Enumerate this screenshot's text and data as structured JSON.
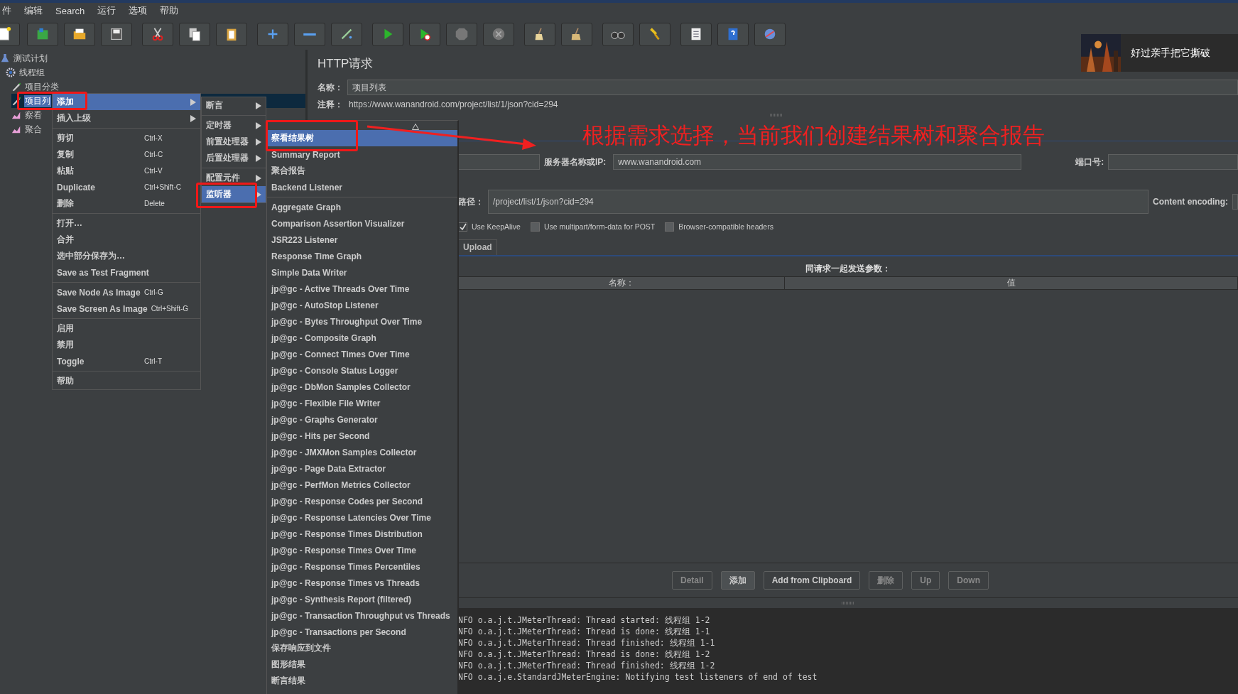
{
  "menu_bar": [
    "件",
    "编辑",
    "Search",
    "运行",
    "选项",
    "帮助"
  ],
  "notification": {
    "text": "好过亲手把它撕破"
  },
  "tree": [
    {
      "kind": "plan",
      "label": "测试计划",
      "selected": false,
      "children": [
        {
          "kind": "thread_group",
          "label": "线程组",
          "selected": false,
          "children": [
            {
              "kind": "sampler",
              "label": "项目分类",
              "selected": false
            },
            {
              "kind": "sampler",
              "label": "项目列",
              "selected": true
            },
            {
              "kind": "listener",
              "label": "察看",
              "selected": false
            },
            {
              "kind": "listener",
              "label": "聚合",
              "selected": false
            }
          ]
        }
      ]
    }
  ],
  "editor": {
    "title": "HTTP请求",
    "name_label": "名称：",
    "name_value": "项目列表",
    "comment_label": "注释：",
    "comment_value": "https://www.wanandroid.com/project/list/1/json?cid=294",
    "server_label": "服务器名称或IP:",
    "server_value": "www.wanandroid.com",
    "port_label": "端口号:",
    "path_label": "路径：",
    "path_value": "/project/list/1/json?cid=294",
    "encoding_label": "Content encoding:",
    "options": [
      {
        "label": "Use KeepAlive",
        "checked": true
      },
      {
        "label": "Use multipart/form-data for POST",
        "checked": false
      },
      {
        "label": "Browser-compatible headers",
        "checked": false
      }
    ],
    "tabs": [
      {
        "label": "Upload",
        "selected": false
      }
    ],
    "params_title": "同请求一起发送参数：",
    "columns": [
      "名称：",
      "值"
    ],
    "buttons": [
      {
        "label": "Detail",
        "disabled": true
      },
      {
        "label": "添加",
        "disabled": false
      },
      {
        "label": "Add from Clipboard",
        "disabled": false
      },
      {
        "label": "删除",
        "disabled": true
      },
      {
        "label": "Up",
        "disabled": true
      },
      {
        "label": "Down",
        "disabled": true
      }
    ]
  },
  "log": [
    "NFO o.a.j.t.JMeterThread: Thread started: 线程组 1-2",
    "NFO o.a.j.t.JMeterThread: Thread is done: 线程组 1-1",
    "NFO o.a.j.t.JMeterThread: Thread finished: 线程组 1-1",
    "NFO o.a.j.t.JMeterThread: Thread is done: 线程组 1-2",
    "NFO o.a.j.t.JMeterThread: Thread finished: 线程组 1-2",
    "NFO o.a.j.e.StandardJMeterEngine: Notifying test listeners of end of test"
  ],
  "context_menu": {
    "items": [
      {
        "kind": "item",
        "label": "添加",
        "submenu": true,
        "selected": true
      },
      {
        "kind": "item",
        "label": "插入上级",
        "submenu": true,
        "selected": false
      },
      {
        "kind": "separator"
      },
      {
        "kind": "item",
        "label": "剪切",
        "shortcut": "Ctrl-X",
        "selected": false
      },
      {
        "kind": "item",
        "label": "复制",
        "shortcut": "Ctrl-C",
        "selected": false
      },
      {
        "kind": "item",
        "label": "粘贴",
        "shortcut": "Ctrl-V",
        "selected": false
      },
      {
        "kind": "item",
        "label": "Duplicate",
        "shortcut": "Ctrl+Shift-C",
        "selected": false
      },
      {
        "kind": "item",
        "label": "删除",
        "shortcut": "Delete",
        "selected": false
      },
      {
        "kind": "separator"
      },
      {
        "kind": "item",
        "label": "打开…",
        "selected": false
      },
      {
        "kind": "item",
        "label": "合并",
        "selected": false
      },
      {
        "kind": "item",
        "label": "选中部分保存为…",
        "selected": false
      },
      {
        "kind": "item",
        "label": "Save as Test Fragment",
        "selected": false
      },
      {
        "kind": "separator"
      },
      {
        "kind": "item",
        "label": "Save Node As Image",
        "shortcut": "Ctrl-G",
        "selected": false
      },
      {
        "kind": "item",
        "label": "Save Screen As Image",
        "shortcut": "Ctrl+Shift-G",
        "selected": false
      },
      {
        "kind": "separator"
      },
      {
        "kind": "item",
        "label": "启用",
        "selected": false
      },
      {
        "kind": "item",
        "label": "禁用",
        "selected": false
      },
      {
        "kind": "item",
        "label": "Toggle",
        "shortcut": "Ctrl-T",
        "selected": false
      },
      {
        "kind": "separator"
      },
      {
        "kind": "item",
        "label": "帮助",
        "selected": false
      }
    ]
  },
  "add_menu": {
    "items": [
      {
        "kind": "item",
        "label": "断言",
        "submenu": true,
        "selected": false
      },
      {
        "kind": "separator"
      },
      {
        "kind": "item",
        "label": "定时器",
        "submenu": true,
        "selected": false
      },
      {
        "kind": "item",
        "label": "前置处理器",
        "submenu": true,
        "selected": false
      },
      {
        "kind": "item",
        "label": "后置处理器",
        "submenu": true,
        "selected": false
      },
      {
        "kind": "separator"
      },
      {
        "kind": "item",
        "label": "配置元件",
        "submenu": true,
        "selected": false
      },
      {
        "kind": "item",
        "label": "监听器",
        "submenu": true,
        "selected": true
      }
    ]
  },
  "listener_menu": {
    "items": [
      {
        "kind": "item",
        "label": "察看结果树",
        "selected": true
      },
      {
        "kind": "item",
        "label": "Summary Report",
        "selected": false
      },
      {
        "kind": "item",
        "label": "聚合报告",
        "selected": false
      },
      {
        "kind": "item",
        "label": "Backend Listener",
        "selected": false
      },
      {
        "kind": "separator"
      },
      {
        "kind": "item",
        "label": "Aggregate Graph",
        "selected": false
      },
      {
        "kind": "item",
        "label": "Comparison Assertion Visualizer",
        "selected": false
      },
      {
        "kind": "item",
        "label": "JSR223 Listener",
        "selected": false
      },
      {
        "kind": "item",
        "label": "Response Time Graph",
        "selected": false
      },
      {
        "kind": "item",
        "label": "Simple Data Writer",
        "selected": false
      },
      {
        "kind": "item",
        "label": "jp@gc - Active Threads Over Time",
        "selected": false
      },
      {
        "kind": "item",
        "label": "jp@gc - AutoStop Listener",
        "selected": false
      },
      {
        "kind": "item",
        "label": "jp@gc - Bytes Throughput Over Time",
        "selected": false
      },
      {
        "kind": "item",
        "label": "jp@gc - Composite Graph",
        "selected": false
      },
      {
        "kind": "item",
        "label": "jp@gc - Connect Times Over Time",
        "selected": false
      },
      {
        "kind": "item",
        "label": "jp@gc - Console Status Logger",
        "selected": false
      },
      {
        "kind": "item",
        "label": "jp@gc - DbMon Samples Collector",
        "selected": false
      },
      {
        "kind": "item",
        "label": "jp@gc - Flexible File Writer",
        "selected": false
      },
      {
        "kind": "item",
        "label": "jp@gc - Graphs Generator",
        "selected": false
      },
      {
        "kind": "item",
        "label": "jp@gc - Hits per Second",
        "selected": false
      },
      {
        "kind": "item",
        "label": "jp@gc - JMXMon Samples Collector",
        "selected": false
      },
      {
        "kind": "item",
        "label": "jp@gc - Page Data Extractor",
        "selected": false
      },
      {
        "kind": "item",
        "label": "jp@gc - PerfMon Metrics Collector",
        "selected": false
      },
      {
        "kind": "item",
        "label": "jp@gc - Response Codes per Second",
        "selected": false
      },
      {
        "kind": "item",
        "label": "jp@gc - Response Latencies Over Time",
        "selected": false
      },
      {
        "kind": "item",
        "label": "jp@gc - Response Times Distribution",
        "selected": false
      },
      {
        "kind": "item",
        "label": "jp@gc - Response Times Over Time",
        "selected": false
      },
      {
        "kind": "item",
        "label": "jp@gc - Response Times Percentiles",
        "selected": false
      },
      {
        "kind": "item",
        "label": "jp@gc - Response Times vs Threads",
        "selected": false
      },
      {
        "kind": "item",
        "label": "jp@gc - Synthesis Report (filtered)",
        "selected": false
      },
      {
        "kind": "item",
        "label": "jp@gc - Transaction Throughput vs Threads",
        "selected": false
      },
      {
        "kind": "item",
        "label": "jp@gc - Transactions per Second",
        "selected": false
      },
      {
        "kind": "item",
        "label": "保存响应到文件",
        "selected": false
      },
      {
        "kind": "item",
        "label": "图形结果",
        "selected": false
      },
      {
        "kind": "item",
        "label": "断言结果",
        "selected": false
      }
    ]
  },
  "annotation": {
    "text": "根据需求选择，当前我们创建结果树和聚合报告"
  }
}
